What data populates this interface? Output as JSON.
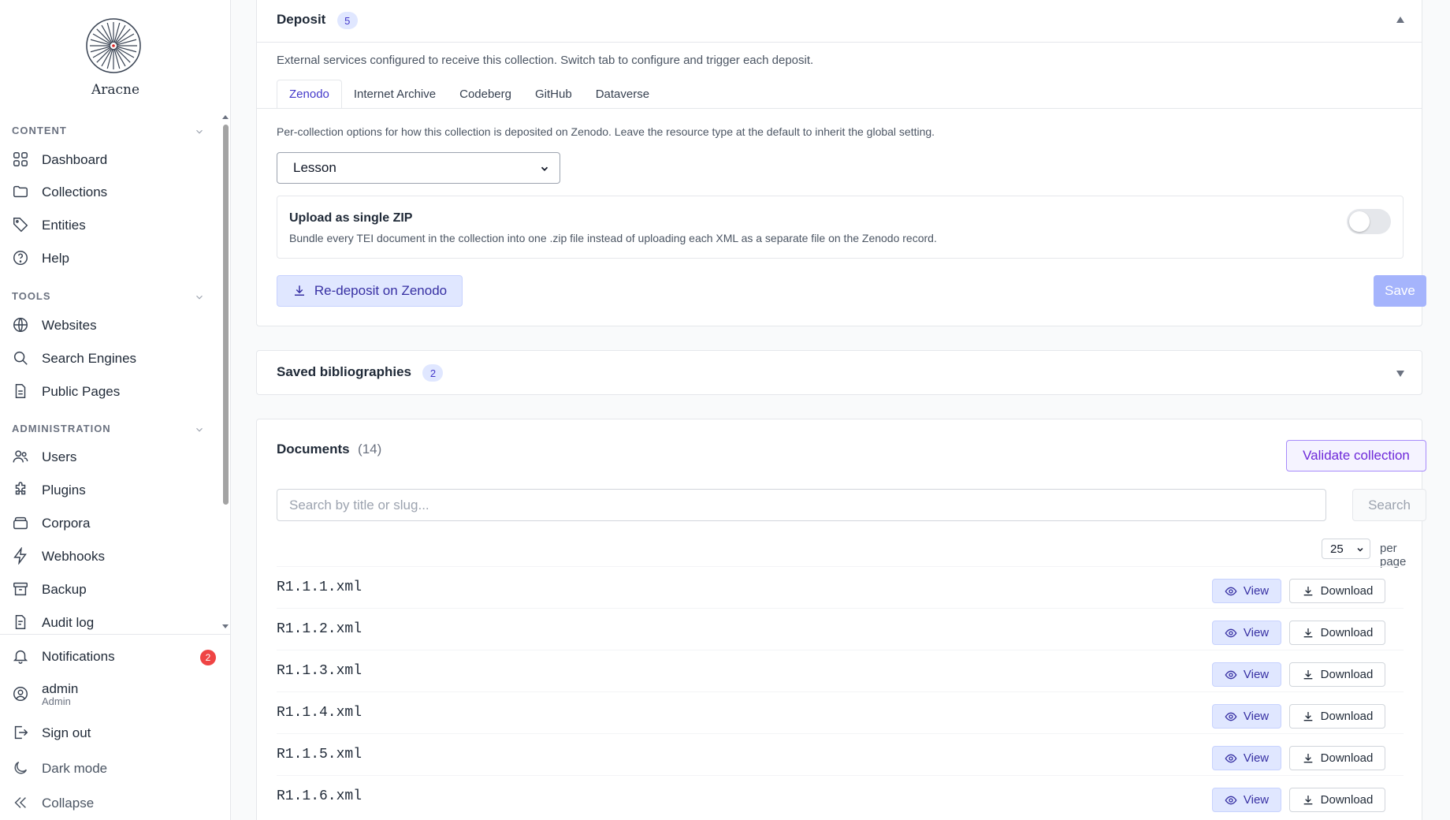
{
  "brand": {
    "name": "Aracne",
    "logo_icon": "radial-lines-logo"
  },
  "sidebar": {
    "sections": [
      {
        "title": "CONTENT",
        "items": [
          {
            "label": "Dashboard",
            "icon": "grid-icon"
          },
          {
            "label": "Collections",
            "icon": "folder-icon"
          },
          {
            "label": "Entities",
            "icon": "tag-icon"
          },
          {
            "label": "Help",
            "icon": "help-circle-icon"
          }
        ]
      },
      {
        "title": "TOOLS",
        "items": [
          {
            "label": "Websites",
            "icon": "globe-icon"
          },
          {
            "label": "Search Engines",
            "icon": "search-icon"
          },
          {
            "label": "Public Pages",
            "icon": "file-icon"
          }
        ]
      },
      {
        "title": "ADMINISTRATION",
        "items": [
          {
            "label": "Users",
            "icon": "users-icon"
          },
          {
            "label": "Plugins",
            "icon": "puzzle-icon"
          },
          {
            "label": "Corpora",
            "icon": "layers-icon"
          },
          {
            "label": "Webhooks",
            "icon": "bolt-icon"
          },
          {
            "label": "Backup",
            "icon": "archive-icon"
          },
          {
            "label": "Audit log",
            "icon": "file-text-icon"
          }
        ]
      }
    ],
    "bottom": {
      "notifications": {
        "label": "Notifications",
        "count": "2"
      },
      "user": {
        "name": "admin",
        "role": "Admin"
      },
      "sign_out": "Sign out",
      "dark_mode": "Dark mode",
      "collapse": "Collapse"
    }
  },
  "deposit": {
    "title": "Deposit",
    "count": "5",
    "description": "External services configured to receive this collection. Switch tab to configure and trigger each deposit.",
    "tabs": [
      "Zenodo",
      "Internet Archive",
      "Codeberg",
      "GitHub",
      "Dataverse"
    ],
    "active_tab": "Zenodo",
    "options_text": "Per-collection options for how this collection is deposited on Zenodo. Leave the resource type at the default to inherit the global setting.",
    "resource_type": "Lesson",
    "zip": {
      "title": "Upload as single ZIP",
      "description": "Bundle every TEI document in the collection into one .zip file instead of uploading each XML as a separate file on the Zenodo record.",
      "enabled": false
    },
    "redeposit_label": "Re-deposit on Zenodo",
    "save_label": "Save"
  },
  "bibliographies": {
    "title": "Saved bibliographies",
    "count": "2"
  },
  "documents": {
    "title": "Documents",
    "count": "(14)",
    "validate_label": "Validate collection",
    "search_placeholder": "Search by title or slug...",
    "search_label": "Search",
    "per_page_value": "25",
    "per_page_label": "per page",
    "view_label": "View",
    "download_label": "Download",
    "rows": [
      "R1.1.1.xml",
      "R1.1.2.xml",
      "R1.1.3.xml",
      "R1.1.4.xml",
      "R1.1.5.xml",
      "R1.1.6.xml"
    ]
  },
  "colors": {
    "accent": "#4338ca",
    "accent_light": "#e0e7ff",
    "danger": "#ef4444"
  }
}
